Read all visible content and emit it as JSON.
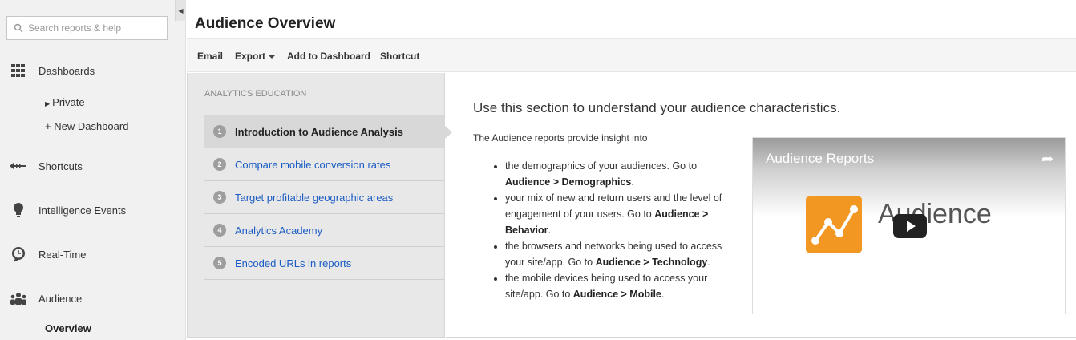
{
  "search": {
    "placeholder": "Search reports & help"
  },
  "sidebar": {
    "dashboards": "Dashboards",
    "dashboards_sub": [
      "Private",
      "+ New Dashboard"
    ],
    "shortcuts": "Shortcuts",
    "intelligence": "Intelligence Events",
    "realtime": "Real-Time",
    "audience": "Audience",
    "audience_sub": "Overview"
  },
  "header": {
    "title": "Audience Overview"
  },
  "toolbar": {
    "email": "Email",
    "export": "Export",
    "add_dashboard": "Add to Dashboard",
    "shortcut": "Shortcut"
  },
  "education": {
    "heading": "ANALYTICS EDUCATION",
    "steps": [
      {
        "num": "1",
        "label": "Introduction to Audience Analysis"
      },
      {
        "num": "2",
        "label": "Compare mobile conversion rates"
      },
      {
        "num": "3",
        "label": "Target profitable geographic areas"
      },
      {
        "num": "4",
        "label": "Analytics Academy"
      },
      {
        "num": "5",
        "label": "Encoded URLs in reports"
      }
    ],
    "title": "Use this section to understand your audience characteristics.",
    "intro": "The Audience reports provide insight into",
    "bullets": [
      {
        "text": "the demographics of your audiences. Go to ",
        "bold": "Audience > Demographics",
        "end": "."
      },
      {
        "text": "your mix of new and return users and the level of engagement of your users. Go to ",
        "bold": "Audience > Behavior",
        "end": "."
      },
      {
        "text": "the browsers and networks being used to access your site/app. Go to ",
        "bold": "Audience > Technology",
        "end": "."
      },
      {
        "text": "the mobile devices being used to access your site/app. Go to ",
        "bold": "Audience > Mobile",
        "end": "."
      }
    ],
    "video": {
      "title": "Audience Reports",
      "brand": "Audience"
    }
  },
  "colors": {
    "link": "#1a5bc4",
    "logo": "#f19722"
  }
}
